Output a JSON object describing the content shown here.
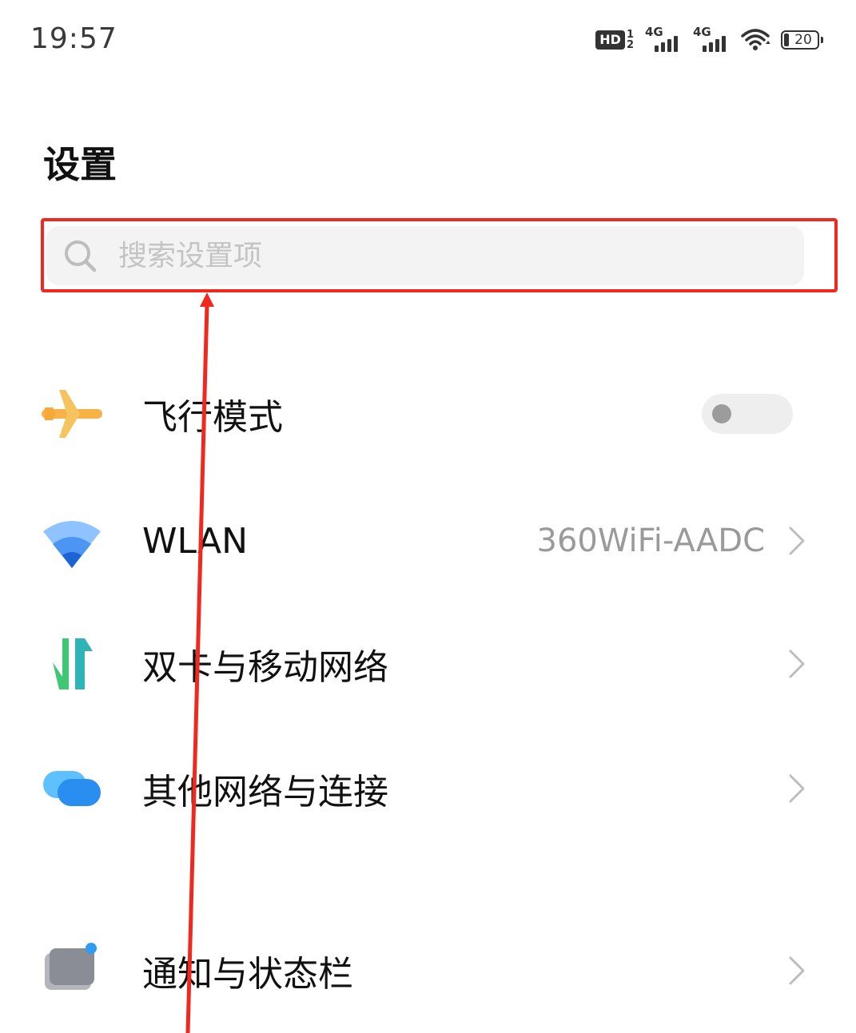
{
  "status_bar": {
    "time": "19:57",
    "hd_label": "HD",
    "hd_sub_top": "1",
    "hd_sub_bottom": "2",
    "sim1_label": "4G",
    "sim2_label": "4G",
    "battery_level": "20",
    "icons": [
      "hd-voice-icon",
      "signal-4g-icon",
      "signal-4g-icon",
      "wifi-icon",
      "battery-icon"
    ]
  },
  "page": {
    "title": "设置"
  },
  "search": {
    "placeholder": "搜索设置项",
    "value": ""
  },
  "settings": [
    {
      "icon": "airplane-icon",
      "label": "飞行模式",
      "control": "toggle",
      "toggle_on": false
    },
    {
      "icon": "wifi-icon",
      "label": "WLAN",
      "value": "360WiFi-AADC",
      "control": "chevron"
    },
    {
      "icon": "mobile-data-icon",
      "label": "双卡与移动网络",
      "control": "chevron"
    },
    {
      "icon": "connections-icon",
      "label": "其他网络与连接",
      "control": "chevron"
    },
    {
      "icon": "notification-icon",
      "label": "通知与状态栏",
      "control": "chevron"
    }
  ],
  "colors": {
    "annotation": "#f0281e",
    "airplane": "#f7b347",
    "wifi": "#3a86f0",
    "mobile_data_green": "#3fc776",
    "mobile_data_teal": "#2ca8c8",
    "connections": "#2f9bf3",
    "notification": "#8a8d95"
  }
}
